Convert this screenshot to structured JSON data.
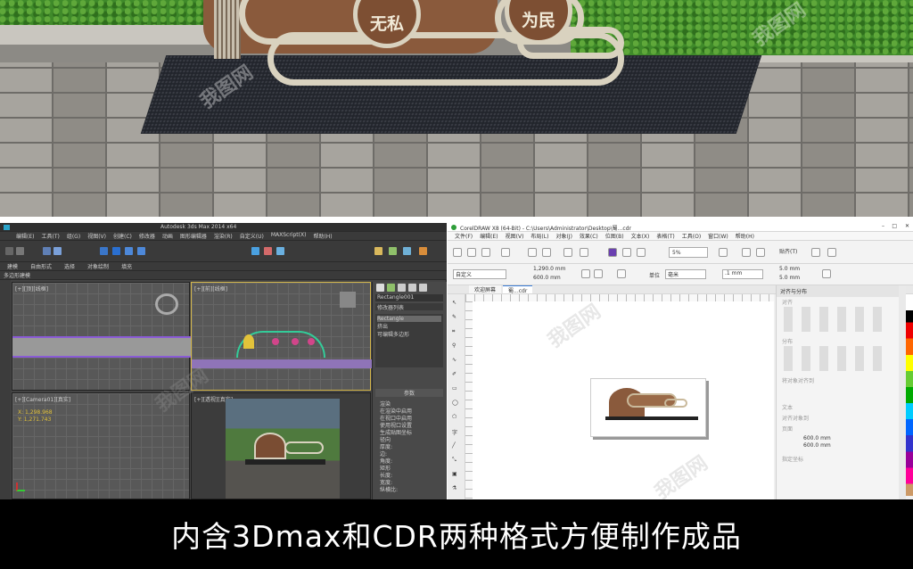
{
  "photo": {
    "seal_left": "无私",
    "seal_right": "为民",
    "watermark": "我图网"
  },
  "max": {
    "title_text": "Autodesk 3ds Max 2014 x64",
    "menu": [
      "编辑(E)",
      "工具(T)",
      "组(G)",
      "视图(V)",
      "创建(C)",
      "修改器",
      "动画",
      "图形编辑器",
      "渲染(R)",
      "自定义(U)",
      "MAXScript(X)",
      "帮助(H)"
    ],
    "tabs": [
      "建模",
      "自由形式",
      "选择",
      "对象绘制",
      "填充"
    ],
    "ribbon_label": "多边形建模",
    "viewport_labels": [
      "[+][顶][线框]",
      "[+][前][线框]",
      "[+][Camera01][真实]",
      "[+][透视][真实]"
    ],
    "panel_title": "Rectangle001",
    "panel_list": [
      "修改器列表",
      "Rectangle",
      "挤出",
      "可编辑多边形"
    ],
    "param_title": "参数",
    "param_items": [
      "渲染",
      "在渲染中启用",
      "在视口中启用",
      "使用视口设置",
      "生成贴图坐标",
      "径向",
      "厚度:",
      "边:",
      "角度:",
      "矩形",
      "长度:",
      "宽度:",
      "纵横比:"
    ],
    "coords": [
      "X: 1,298.968",
      "Y: 1,271.743"
    ]
  },
  "cdr": {
    "title_text": "CorelDRAW X8 (64-Bit) - C:\\Users\\Administrator\\Desktop\\蜀...cdr",
    "menu": [
      "文件(F)",
      "编辑(E)",
      "视图(V)",
      "布局(L)",
      "对象(J)",
      "效果(C)",
      "位图(B)",
      "文本(X)",
      "表格(T)",
      "工具(O)",
      "窗口(W)",
      "帮助(H)"
    ],
    "zoom": "5%",
    "snap_label": "贴齐(T)",
    "paper_preset": "自定义",
    "width_value": "1,290.0 mm",
    "height_value": "600.0 mm",
    "units_label": "单位",
    "units_value": "毫米",
    "nudge_value": ".1 mm",
    "dup_x": "5.0 mm",
    "dup_y": "5.0 mm",
    "tabs": [
      "欢迎屏幕",
      "蜀...cdr"
    ],
    "docker_title": "对齐与分布",
    "docker_sections": [
      "对齐",
      "分布",
      "将对象对齐到",
      "文本",
      "对齐对象到",
      "页面",
      "指定坐标"
    ],
    "docker_values": [
      "600.0 mm",
      "600.0 mm"
    ]
  },
  "caption": "内含3Dmax和CDR两种格式方便制作成品",
  "colors": {
    "accent_brown": "#8a5a3c",
    "cream": "#d9d2bf",
    "caption_bg": "#000000"
  }
}
